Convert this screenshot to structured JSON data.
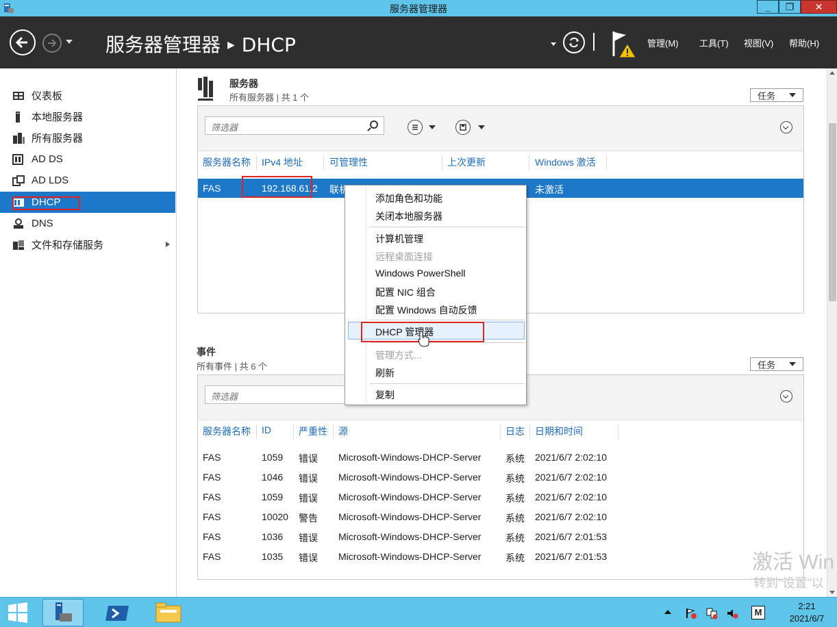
{
  "window": {
    "title": "服务器管理器",
    "min_glyph": "_",
    "max_glyph": "❐",
    "close_glyph": "✕"
  },
  "header": {
    "breadcrumb_root": "服务器管理器",
    "breadcrumb_sep": "▶",
    "breadcrumb_current": "DHCP",
    "menus": [
      "管理(M)",
      "工具(T)",
      "视图(V)",
      "帮助(H)"
    ]
  },
  "sidebar": {
    "items": [
      {
        "label": "仪表板",
        "icon": "dashboard-icon"
      },
      {
        "label": "本地服务器",
        "icon": "local-server-icon"
      },
      {
        "label": "所有服务器",
        "icon": "all-servers-icon"
      },
      {
        "label": "AD DS",
        "icon": "adds-icon"
      },
      {
        "label": "AD LDS",
        "icon": "adlds-icon"
      },
      {
        "label": "DHCP",
        "icon": "dhcp-icon"
      },
      {
        "label": "DNS",
        "icon": "dns-icon"
      },
      {
        "label": "文件和存储服务",
        "icon": "file-storage-icon"
      }
    ],
    "active_index": 5
  },
  "servers": {
    "title": "服务器",
    "subtitle": "所有服务器 | 共 1 个",
    "tasks_label": "任务",
    "filter_placeholder": "筛选器",
    "columns": [
      "服务器名称",
      "IPv4 地址",
      "可管理性",
      "上次更新",
      "Windows 激活"
    ],
    "rows": [
      {
        "name": "FAS",
        "ipv4": "192.168.61.2",
        "manageability": "联机",
        "last_update": "",
        "activation": "未激活"
      }
    ]
  },
  "events": {
    "title": "事件",
    "subtitle": "所有事件 | 共 6 个",
    "tasks_label": "任务",
    "filter_placeholder": "筛选器",
    "columns": [
      "服务器名称",
      "ID",
      "严重性",
      "源",
      "日志",
      "日期和时间"
    ],
    "rows": [
      {
        "server": "FAS",
        "id": "1059",
        "severity": "错误",
        "source": "Microsoft-Windows-DHCP-Server",
        "log": "系统",
        "datetime": "2021/6/7 2:02:10"
      },
      {
        "server": "FAS",
        "id": "1046",
        "severity": "错误",
        "source": "Microsoft-Windows-DHCP-Server",
        "log": "系统",
        "datetime": "2021/6/7 2:02:10"
      },
      {
        "server": "FAS",
        "id": "1059",
        "severity": "错误",
        "source": "Microsoft-Windows-DHCP-Server",
        "log": "系统",
        "datetime": "2021/6/7 2:02:10"
      },
      {
        "server": "FAS",
        "id": "10020",
        "severity": "警告",
        "source": "Microsoft-Windows-DHCP-Server",
        "log": "系统",
        "datetime": "2021/6/7 2:02:10"
      },
      {
        "server": "FAS",
        "id": "1036",
        "severity": "错误",
        "source": "Microsoft-Windows-DHCP-Server",
        "log": "系统",
        "datetime": "2021/6/7 2:01:53"
      },
      {
        "server": "FAS",
        "id": "1035",
        "severity": "错误",
        "source": "Microsoft-Windows-DHCP-Server",
        "log": "系统",
        "datetime": "2021/6/7 2:01:53"
      }
    ]
  },
  "context_menu": {
    "items": [
      {
        "label": "添加角色和功能",
        "disabled": false
      },
      {
        "label": "关闭本地服务器",
        "disabled": false
      },
      {
        "label": "计算机管理",
        "disabled": false
      },
      {
        "label": "远程桌面连接",
        "disabled": true
      },
      {
        "label": "Windows PowerShell",
        "disabled": false
      },
      {
        "label": "配置 NIC 组合",
        "disabled": false
      },
      {
        "label": "配置 Windows 自动反馈",
        "disabled": false
      },
      {
        "label": "DHCP 管理器",
        "disabled": false
      },
      {
        "label": "管理方式...",
        "disabled": true
      },
      {
        "label": "刷新",
        "disabled": false
      },
      {
        "label": "复制",
        "disabled": false
      }
    ],
    "highlighted_index": 7
  },
  "watermark": {
    "line1": "激活 Win",
    "line2": "转到\"设置\"以"
  },
  "taskbar": {
    "apps": [
      "start-icon",
      "server-manager-icon",
      "powershell-icon",
      "file-explorer-icon"
    ],
    "tray_ime": "M",
    "time": "2:21",
    "date": "2021/6/7"
  },
  "colors": {
    "titlebar": "#5fc4e9",
    "header": "#2e2e2e",
    "selection": "#1e78c8",
    "link": "#1e6bb8",
    "annotation": "#e02424"
  }
}
